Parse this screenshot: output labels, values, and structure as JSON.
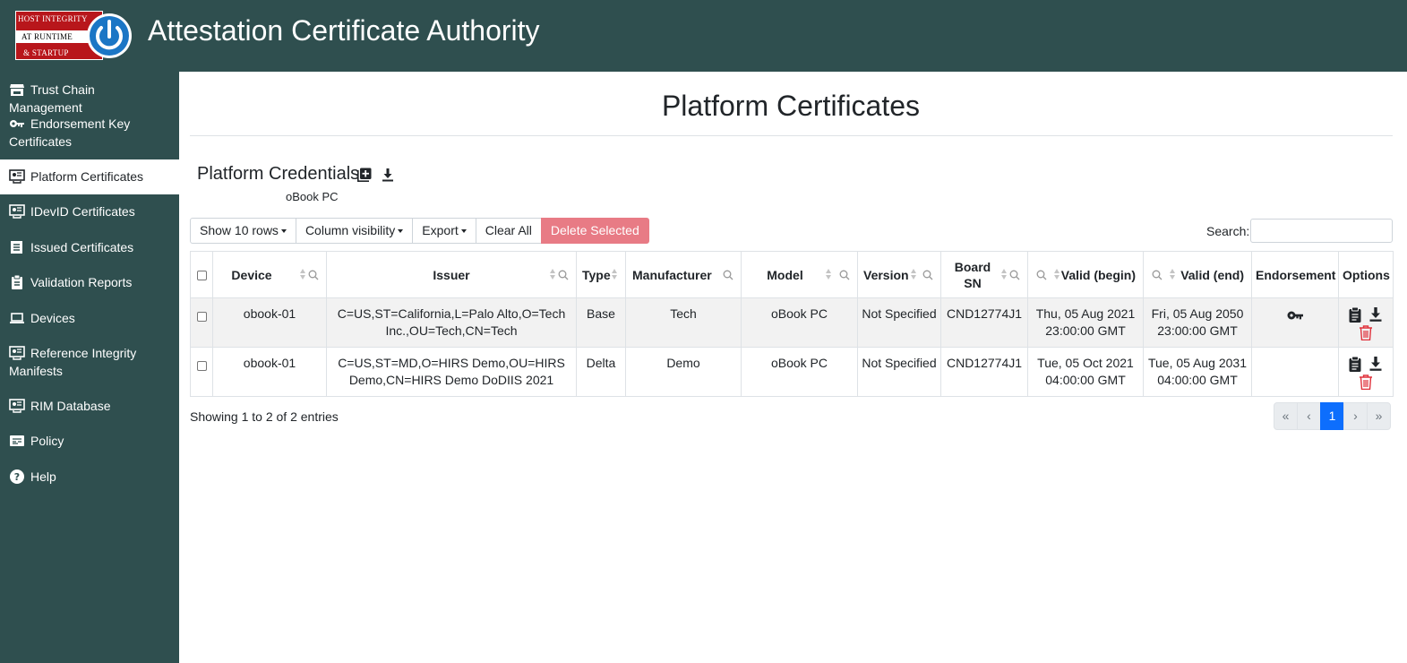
{
  "header": {
    "app_title": "Attestation Certificate Authority",
    "logo": {
      "line1": "HOST INTEGRITY",
      "line2": "AT RUNTIME",
      "line3": "& STARTUP",
      "brand_red": "#b8161b",
      "power_blue": "#1b76c5"
    },
    "background": "#2f4f4f"
  },
  "sidebar": {
    "items": [
      {
        "label": "Trust Chain Management",
        "icon": "store-icon"
      },
      {
        "label": "Endorsement Key Certificates",
        "icon": "key-icon"
      },
      {
        "label": "Platform Certificates",
        "icon": "certificate-monitor-icon",
        "active": true
      },
      {
        "label": "IDevID Certificates",
        "icon": "certificate-monitor-icon"
      },
      {
        "label": "Issued Certificates",
        "icon": "list-icon"
      },
      {
        "label": "Validation Reports",
        "icon": "clipboard-icon"
      },
      {
        "label": "Devices",
        "icon": "laptop-icon"
      },
      {
        "label": "Reference Integrity Manifests",
        "icon": "certificate-monitor-icon"
      },
      {
        "label": "RIM Database",
        "icon": "certificate-monitor-icon"
      },
      {
        "label": "Policy",
        "icon": "policy-card-icon"
      },
      {
        "label": "Help",
        "icon": "help-icon"
      }
    ]
  },
  "main": {
    "page_title": "Platform Certificates",
    "section_title": "Platform Credentials",
    "subtitle": "oBook PC",
    "toolbar": {
      "show_rows": "Show 10 rows",
      "column_visibility": "Column visibility",
      "export": "Export",
      "clear_all": "Clear All",
      "delete_selected": "Delete Selected"
    },
    "search": {
      "label": "Search:",
      "value": ""
    },
    "table": {
      "columns": [
        "Device",
        "Issuer",
        "Type",
        "Manufacturer",
        "Model",
        "Version",
        "Board SN",
        "Valid (begin)",
        "Valid (end)",
        "Endorsement",
        "Options"
      ],
      "board_sn_line1": "Board",
      "board_sn_line2": "SN",
      "rows": [
        {
          "device": "obook-01",
          "issuer_line1": "C=US,ST=California,L=Palo Alto,O=Tech",
          "issuer_line2": "Inc.,OU=Tech,CN=Tech",
          "type": "Base",
          "manufacturer": "Tech",
          "model": "oBook PC",
          "version": "Not Specified",
          "board_sn": "CND12774J1",
          "valid_begin_line1": "Thu, 05 Aug 2021",
          "valid_begin_line2": "23:00:00 GMT",
          "valid_end_line1": "Fri, 05 Aug 2050",
          "valid_end_line2": "23:00:00 GMT",
          "endorsement_icon": "key-icon"
        },
        {
          "device": "obook-01",
          "issuer_line1": "C=US,ST=MD,O=HIRS Demo,OU=HIRS",
          "issuer_line2": "Demo,CN=HIRS Demo DoDIIS 2021",
          "type": "Delta",
          "manufacturer": "Demo",
          "model": "oBook PC",
          "version": "Not Specified",
          "board_sn": "CND12774J1",
          "valid_begin_line1": "Tue, 05 Oct 2021",
          "valid_begin_line2": "04:00:00 GMT",
          "valid_end_line1": "Tue, 05 Aug 2031",
          "valid_end_line2": "04:00:00 GMT",
          "endorsement_icon": ""
        }
      ]
    },
    "footer": {
      "info": "Showing 1 to 2 of 2 entries"
    },
    "pagination": {
      "first": "«",
      "prev": "‹",
      "current": "1",
      "next": "›",
      "last": "»"
    },
    "colors": {
      "danger": "#e87b85",
      "delete_icon": "#e0313b",
      "active_page": "#0d6efd"
    }
  }
}
